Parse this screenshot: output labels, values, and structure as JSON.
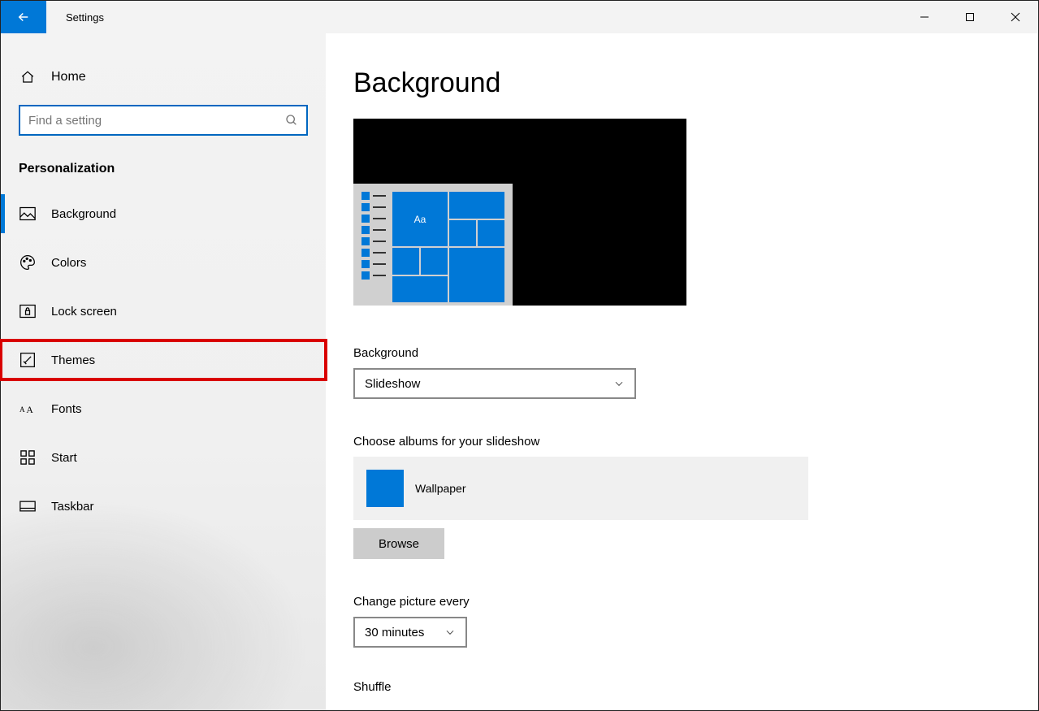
{
  "app": {
    "title": "Settings"
  },
  "sidebar": {
    "home": "Home",
    "search_placeholder": "Find a setting",
    "section": "Personalization",
    "items": [
      {
        "label": "Background"
      },
      {
        "label": "Colors"
      },
      {
        "label": "Lock screen"
      },
      {
        "label": "Themes"
      },
      {
        "label": "Fonts"
      },
      {
        "label": "Start"
      },
      {
        "label": "Taskbar"
      }
    ]
  },
  "main": {
    "title": "Background",
    "preview_sample": "Aa",
    "background_label": "Background",
    "background_value": "Slideshow",
    "albums_label": "Choose albums for your slideshow",
    "album_name": "Wallpaper",
    "browse": "Browse",
    "change_label": "Change picture every",
    "change_value": "30 minutes",
    "shuffle_label": "Shuffle"
  }
}
